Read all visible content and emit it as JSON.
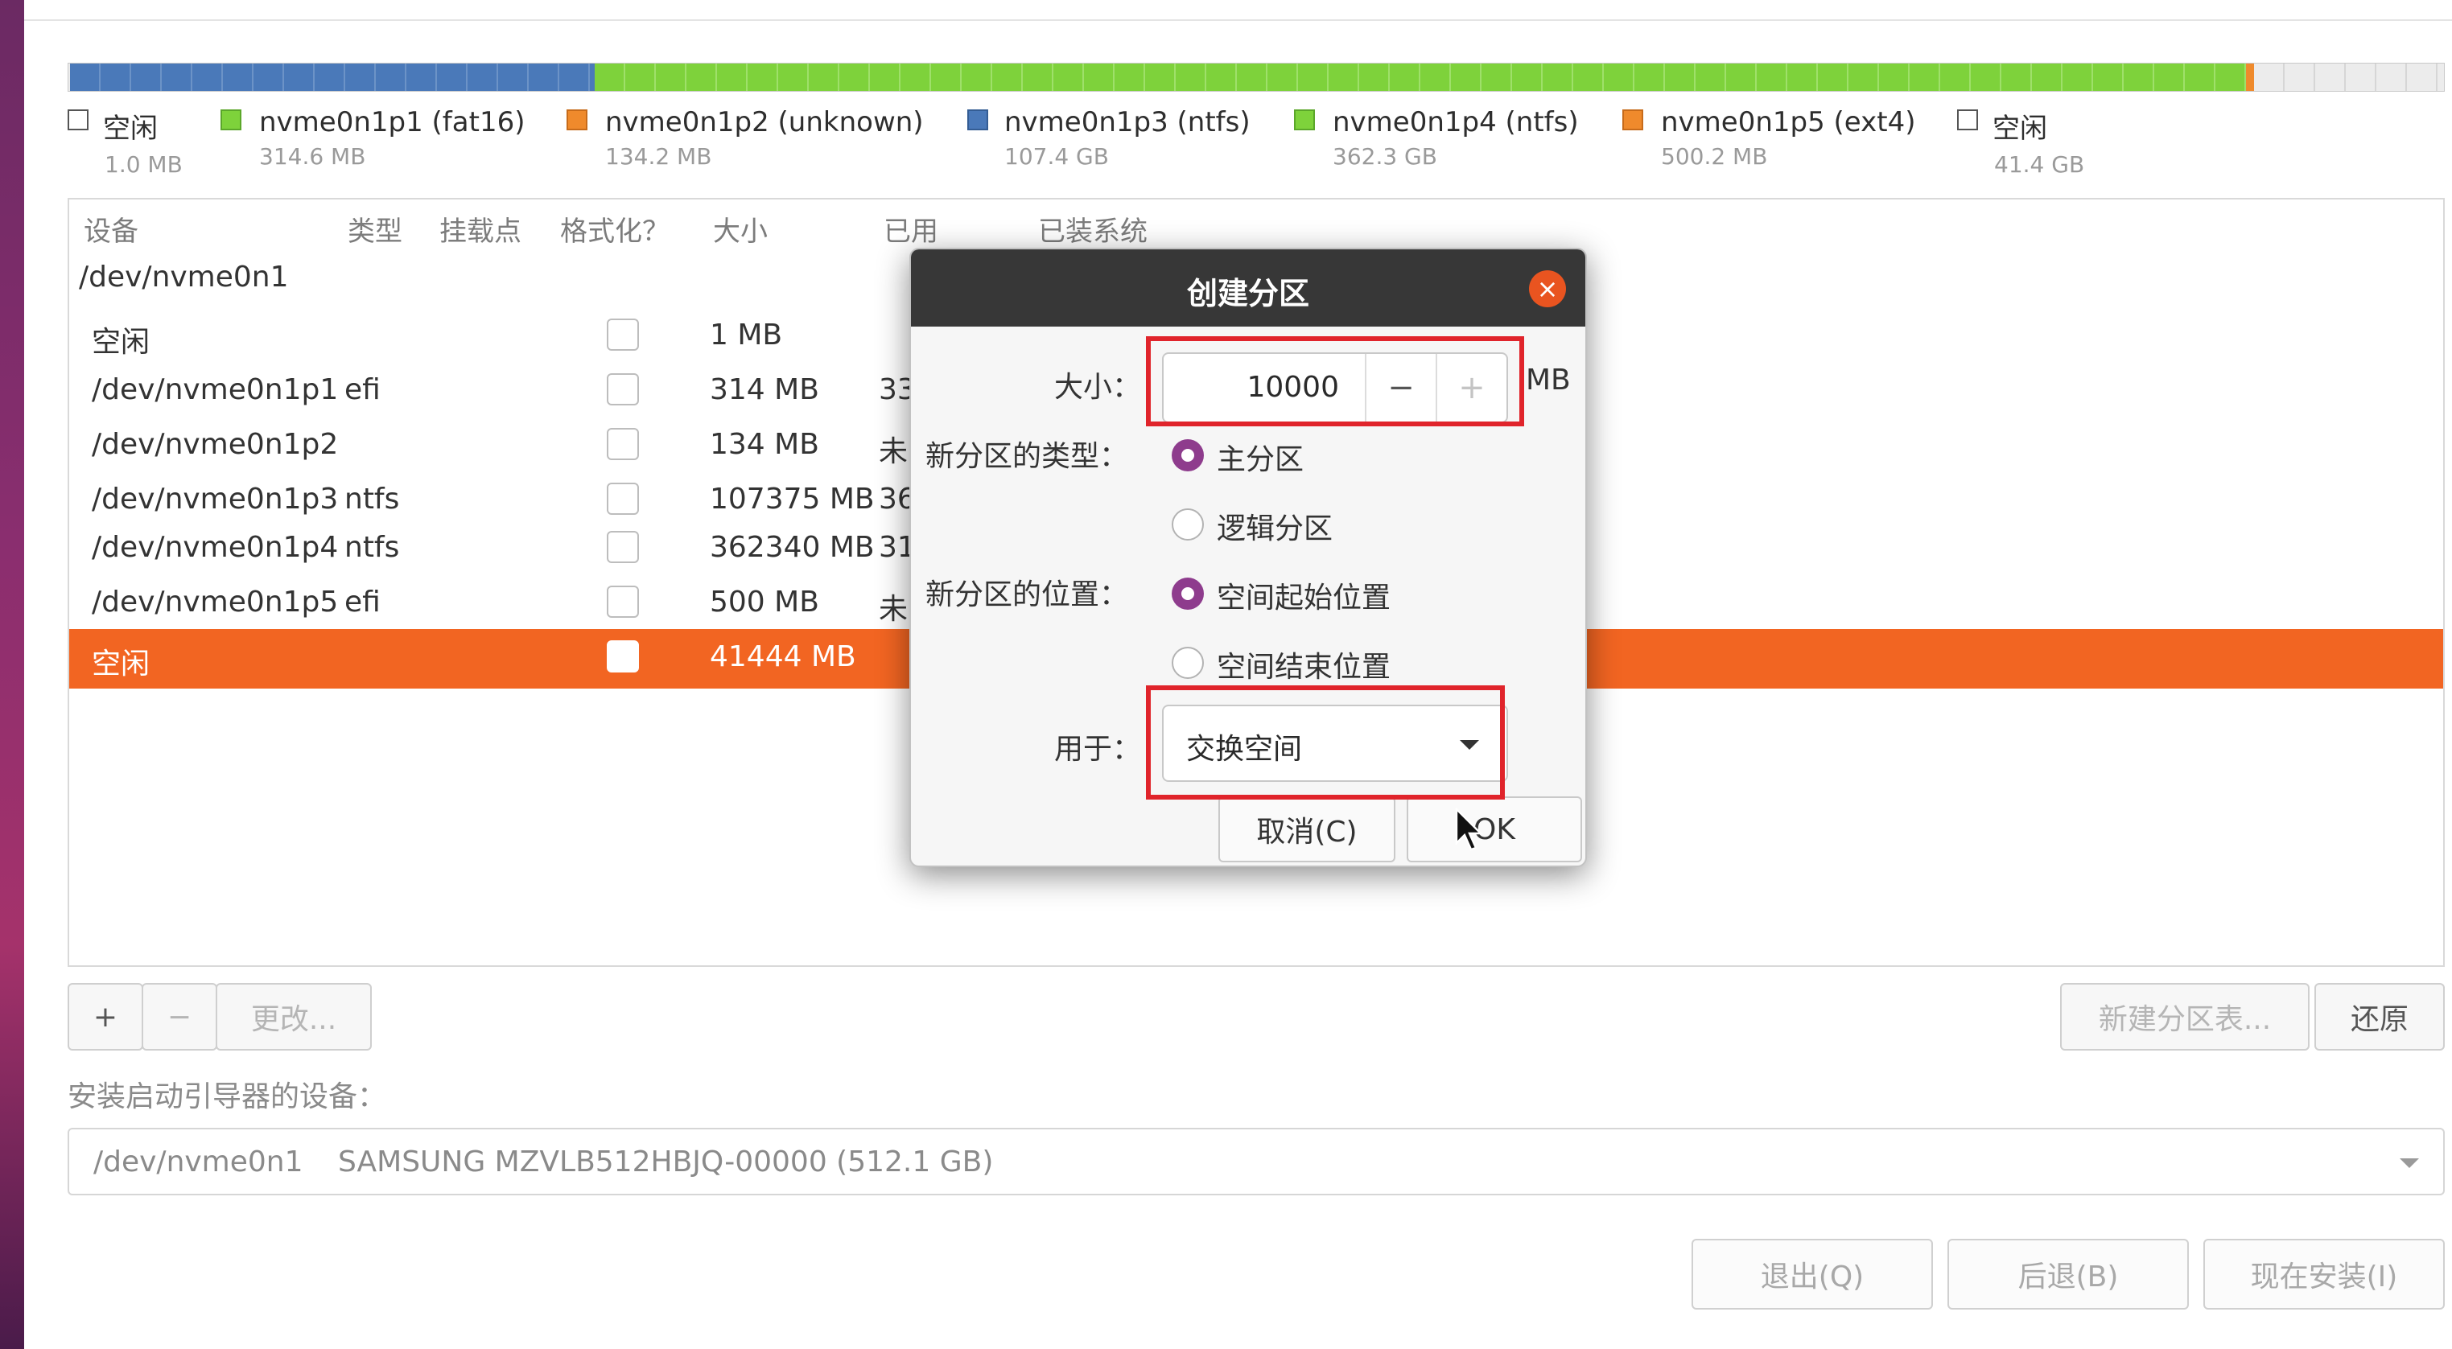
{
  "partition_bar": {
    "segments": [
      {
        "style": "free",
        "fraction": 0.0001
      },
      {
        "style": "blue",
        "fraction": 0.2208
      },
      {
        "style": "green",
        "fraction": 0.6948
      },
      {
        "style": "orange",
        "fraction": 0.0033
      },
      {
        "style": "free",
        "fraction": 0.081
      }
    ]
  },
  "legend": [
    {
      "name": "空闲",
      "size": "1.0 MB",
      "color": "#ffffff"
    },
    {
      "name": "nvme0n1p1 (fat16)",
      "size": "314.6 MB",
      "color": "#7ed23b"
    },
    {
      "name": "nvme0n1p2 (unknown)",
      "size": "134.2 MB",
      "color": "#ef8a2c"
    },
    {
      "name": "nvme0n1p3 (ntfs)",
      "size": "107.4 GB",
      "color": "#4a79b9"
    },
    {
      "name": "nvme0n1p4 (ntfs)",
      "size": "362.3 GB",
      "color": "#7ed23b"
    },
    {
      "name": "nvme0n1p5 (ext4)",
      "size": "500.2 MB",
      "color": "#ef8a2c"
    },
    {
      "name": "空闲",
      "size": "41.4 GB",
      "color": "#ffffff"
    }
  ],
  "table": {
    "headers": {
      "device": "设备",
      "type": "类型",
      "mount": "挂载点",
      "format": "格式化？",
      "size": "大小",
      "used": "已用",
      "system": "已装系统"
    },
    "disk": "/dev/nvme0n1",
    "rows": [
      {
        "device": "空闲",
        "type": "",
        "size": "1 MB",
        "used": ""
      },
      {
        "device": "/dev/nvme0n1p1",
        "type": "efi",
        "size": "314 MB",
        "used": "33"
      },
      {
        "device": "/dev/nvme0n1p2",
        "type": "",
        "size": "134 MB",
        "used": "未"
      },
      {
        "device": "/dev/nvme0n1p3",
        "type": "ntfs",
        "size": "107375 MB",
        "used": "36"
      },
      {
        "device": "/dev/nvme0n1p4",
        "type": "ntfs",
        "size": "362340 MB",
        "used": "31"
      },
      {
        "device": "/dev/nvme0n1p5",
        "type": "efi",
        "size": "500 MB",
        "used": "未"
      },
      {
        "device": "空闲",
        "type": "",
        "size": "41444 MB",
        "used": ""
      }
    ]
  },
  "toolbar": {
    "add": "+",
    "remove": "−",
    "change": "更改..."
  },
  "right_buttons": {
    "new_table": "新建分区表...",
    "revert": "还原"
  },
  "boot": {
    "label": "安装启动引导器的设备：",
    "device": "/dev/nvme0n1",
    "disk": "SAMSUNG MZVLB512HBJQ-00000 (512.1 GB)"
  },
  "bottom_buttons": {
    "quit": "退出(Q)",
    "back": "后退(B)",
    "install": "现在安装(I)"
  },
  "dialog": {
    "title": "创建分区",
    "close": "×",
    "size_label": "大小：",
    "size_value": "10000",
    "minus": "−",
    "plus": "+",
    "unit": "MB",
    "type_label": "新分区的类型：",
    "type_primary": "主分区",
    "type_logical": "逻辑分区",
    "location_label": "新分区的位置：",
    "location_start": "空间起始位置",
    "location_end": "空间结束位置",
    "use_label": "用于：",
    "use_value": "交换空间",
    "cancel": "取消(C)",
    "ok": "OK"
  },
  "colors": {
    "accent": "#e95420",
    "selected_row": "#f26522",
    "radio": "#8e3c8d",
    "highlight": "#e0242b"
  }
}
